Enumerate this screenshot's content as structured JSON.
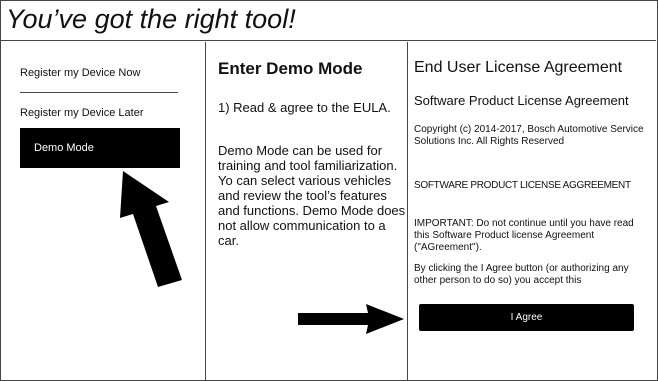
{
  "title": "You’ve got the right tool!",
  "sidebar": {
    "items": [
      {
        "label": "Register my Device Now"
      },
      {
        "label": "Register my Device Later"
      },
      {
        "label": "Demo Mode"
      }
    ]
  },
  "center": {
    "heading": "Enter Demo Mode",
    "step": "1) Read & agree to the EULA.",
    "body": "Demo Mode can be used for training and tool familiarization. Yo can select various vehicles and review the tool’s features and functions. Demo Mode does not allow communication to a car."
  },
  "eula": {
    "heading": "End User License Agreement",
    "subheading": "Software Product License Agreement",
    "copyright": "Copyright (c) 2014-2017, Bosch Automotive Service Solutions Inc. All Rights Reserved",
    "caps_title": "SOFTWARE PRODUCT LICENSE AGGREEMENT",
    "important": "IMPORTANT: Do not continue until you have read this Software Product license Agreement (\"AGreement\").",
    "clicking": "By clicking the I Agree button (or authorizing any other person to do so) you accept this",
    "agree_label": "I Agree"
  },
  "colors": {
    "accent": "#000000",
    "background": "#ffffff",
    "border": "#444444"
  }
}
